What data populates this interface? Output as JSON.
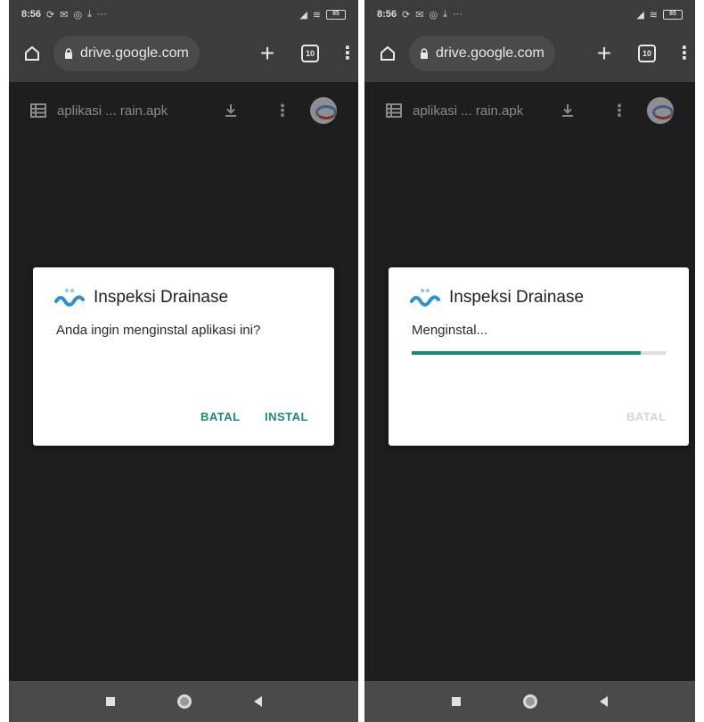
{
  "colors": {
    "accent": "#188a7a",
    "progress": "#138a7b",
    "background": "#1e1e1e",
    "chrome": "#3c3c3c"
  },
  "screens": [
    {
      "status": {
        "time": "8:56",
        "icons": [
          "notification-icon",
          "mail-icon",
          "instagram-icon",
          "download-icon",
          "more-icon"
        ],
        "right_icons": [
          "signal-icon",
          "wifi-icon",
          "battery-icon"
        ],
        "battery": "85"
      },
      "browser": {
        "url": "drive.google.com",
        "tab_count": "10"
      },
      "drive": {
        "file_name": "aplikasi ... rain.apk"
      },
      "dialog": {
        "app_name": "Inspeksi Drainase",
        "message": "Anda ingin menginstal aplikasi ini?",
        "cancel_label": "BATAL",
        "install_label": "INSTAL"
      }
    },
    {
      "status": {
        "time": "8:56",
        "icons": [
          "notification-icon",
          "mail-icon",
          "instagram-icon",
          "download-icon",
          "more-icon"
        ],
        "right_icons": [
          "signal-icon",
          "wifi-icon",
          "battery-icon"
        ],
        "battery": "85"
      },
      "browser": {
        "url": "drive.google.com",
        "tab_count": "10"
      },
      "drive": {
        "file_name": "aplikasi ... rain.apk"
      },
      "dialog": {
        "app_name": "Inspeksi Drainase",
        "message": "Menginstal...",
        "cancel_label": "BATAL",
        "progress": 0.9
      }
    }
  ]
}
